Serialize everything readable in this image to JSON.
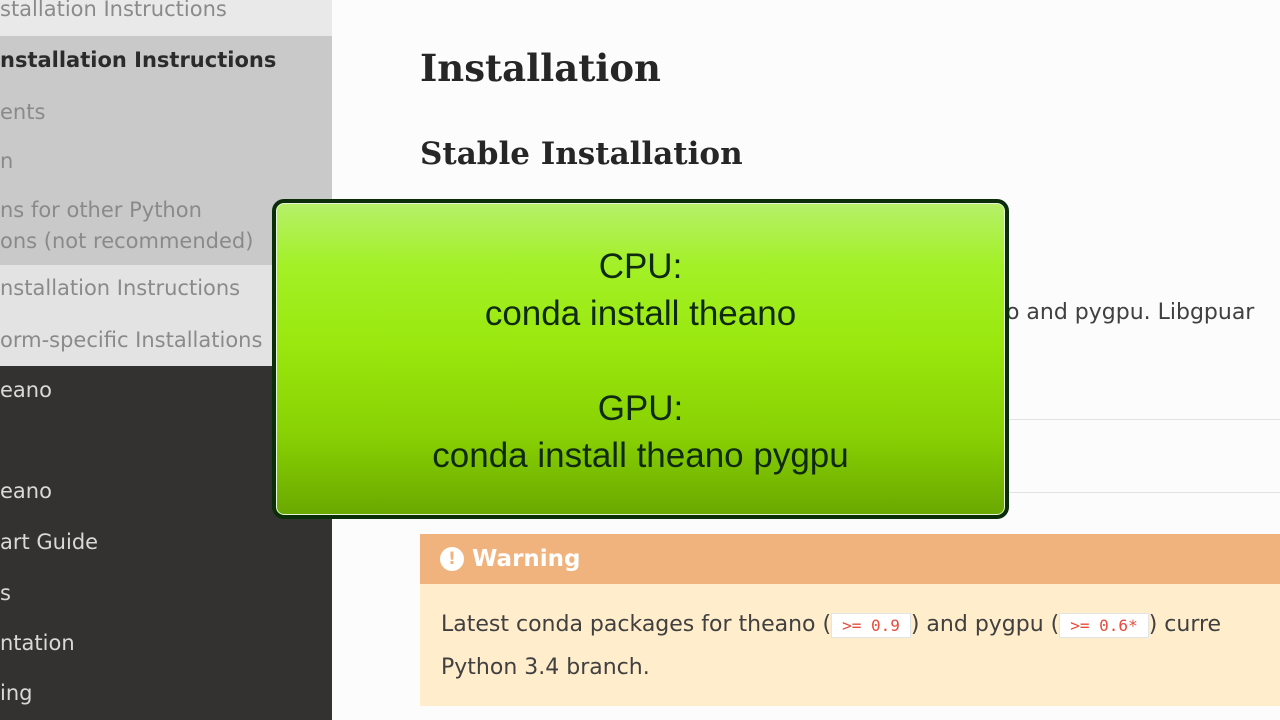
{
  "sidebar": {
    "items": [
      {
        "label": "stallation Instructions"
      },
      {
        "label": "nstallation Instructions"
      },
      {
        "label": "ents"
      },
      {
        "label": "n"
      },
      {
        "label": "ns for other Python"
      },
      {
        "label": "ons (not recommended)"
      },
      {
        "label": "nstallation Instructions"
      },
      {
        "label": "orm-specific Installations"
      },
      {
        "label": "eano"
      },
      {
        "label": "eano"
      },
      {
        "label": "art Guide"
      },
      {
        "label": "s"
      },
      {
        "label": "ntation"
      },
      {
        "label": "ing"
      }
    ]
  },
  "main": {
    "title": "Installation",
    "subtitle": "Stable Installation",
    "partial_text": "no and pygpu. Libgpuar",
    "warning": {
      "title": "Warning",
      "text1": "Latest conda packages for theano (",
      "code1": ">= 0.9",
      "text2": ") and pygpu (",
      "code2": ">= 0.6*",
      "text3": ") curre",
      "line2": "Python 3.4 branch."
    }
  },
  "overlay": {
    "cpu_label": "CPU:",
    "cpu_command": "conda install theano",
    "gpu_label": "GPU:",
    "gpu_command": "conda install theano pygpu"
  },
  "colors": {
    "sidebar_dark": "#343131",
    "warning_header": "#f0b37e",
    "warning_body": "#ffedcc",
    "code_text": "#e74c3c",
    "callout_green": "#9ae80e"
  }
}
